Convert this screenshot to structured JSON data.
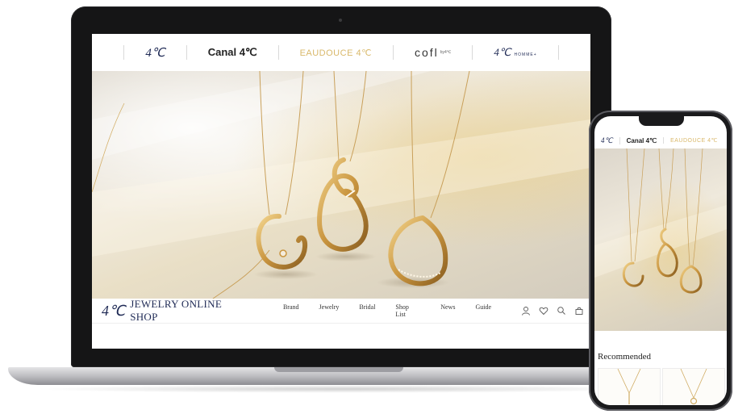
{
  "brands": [
    {
      "id": "4c",
      "label": "4℃"
    },
    {
      "id": "canal",
      "label": "Canal 4℃"
    },
    {
      "id": "eaudouce",
      "label": "EAUDOUCE 4℃"
    },
    {
      "id": "cofl",
      "label": "cofl"
    },
    {
      "id": "homme",
      "label": "4℃"
    }
  ],
  "brand_suffixes": {
    "cofl": "by4℃",
    "homme": "HOMME+"
  },
  "shop": {
    "mark": "4℃",
    "name": "JEWELRY ONLINE SHOP"
  },
  "nav": {
    "items": [
      "Brand",
      "Jewelry",
      "Bridal",
      "Shop List",
      "News",
      "Guide"
    ]
  },
  "nav_icons": [
    "account-icon",
    "heart-icon",
    "search-icon",
    "bag-icon"
  ],
  "phone": {
    "brands": [
      "4℃",
      "Canal 4℃",
      "EAUDOUCE 4℃"
    ],
    "section_title": "Recommended"
  },
  "colors": {
    "brand_navy": "#1f2a55",
    "gold": "#d9b86a",
    "jewelry_gold": "#c9953f"
  }
}
